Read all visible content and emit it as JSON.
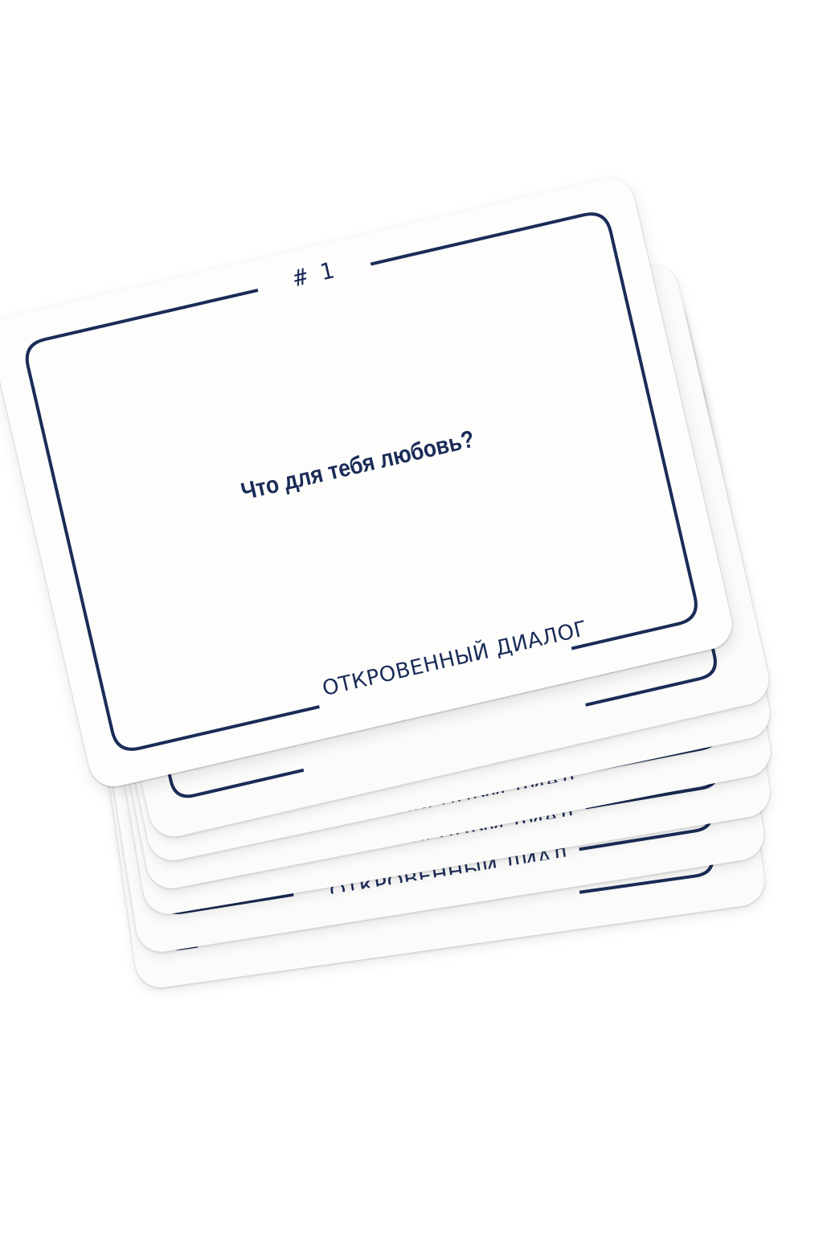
{
  "top_card": {
    "number": "# 1",
    "question": "Что для тебя любовь?",
    "footer": "ОТКРОВЕННЫЙ ДИАЛОГ"
  },
  "stack_cards": [
    {
      "footer": "ОТКРОВЕННЫЙ ДИАЛОГ"
    },
    {
      "footer": "ОТКРОВЕННЫЙ ДИАЛОГ"
    },
    {
      "footer": "ОТКРОВЕННЫЙ ДИАЛОГ"
    },
    {
      "footer": "ОТКРОВЕННЫЙ ДИАЛОГ"
    }
  ],
  "colors": {
    "ink": "#1a2c57",
    "card": "#fdfdfc",
    "background": "#ffffff"
  }
}
